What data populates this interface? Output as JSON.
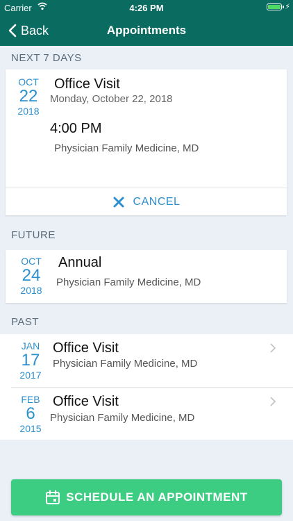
{
  "status": {
    "carrier": "Carrier",
    "time": "4:26 PM"
  },
  "nav": {
    "back_label": "Back",
    "title": "Appointments"
  },
  "sections": {
    "next7": "NEXT 7 DAYS",
    "future": "FUTURE",
    "past": "PAST"
  },
  "upcoming": {
    "month": "OCT",
    "day": "22",
    "year": "2018",
    "title": "Office Visit",
    "date_text": "Monday, October 22, 2018",
    "time": "4:00 PM",
    "provider": "Physician Family Medicine, MD",
    "cancel_label": "CANCEL"
  },
  "future": {
    "month": "OCT",
    "day": "24",
    "year": "2018",
    "title": "Annual",
    "provider": "Physician Family Medicine, MD"
  },
  "past": [
    {
      "month": "JAN",
      "day": "17",
      "year": "2017",
      "title": "Office Visit",
      "provider": "Physician Family Medicine, MD"
    },
    {
      "month": "FEB",
      "day": "6",
      "year": "2015",
      "title": "Office Visit",
      "provider": "Physician Family Medicine, MD"
    }
  ],
  "schedule_label": "SCHEDULE AN APPOINTMENT",
  "colors": {
    "header": "#0a6b60",
    "accent": "#2c8fce",
    "button": "#3ccc82",
    "background": "#eaf0f6"
  }
}
